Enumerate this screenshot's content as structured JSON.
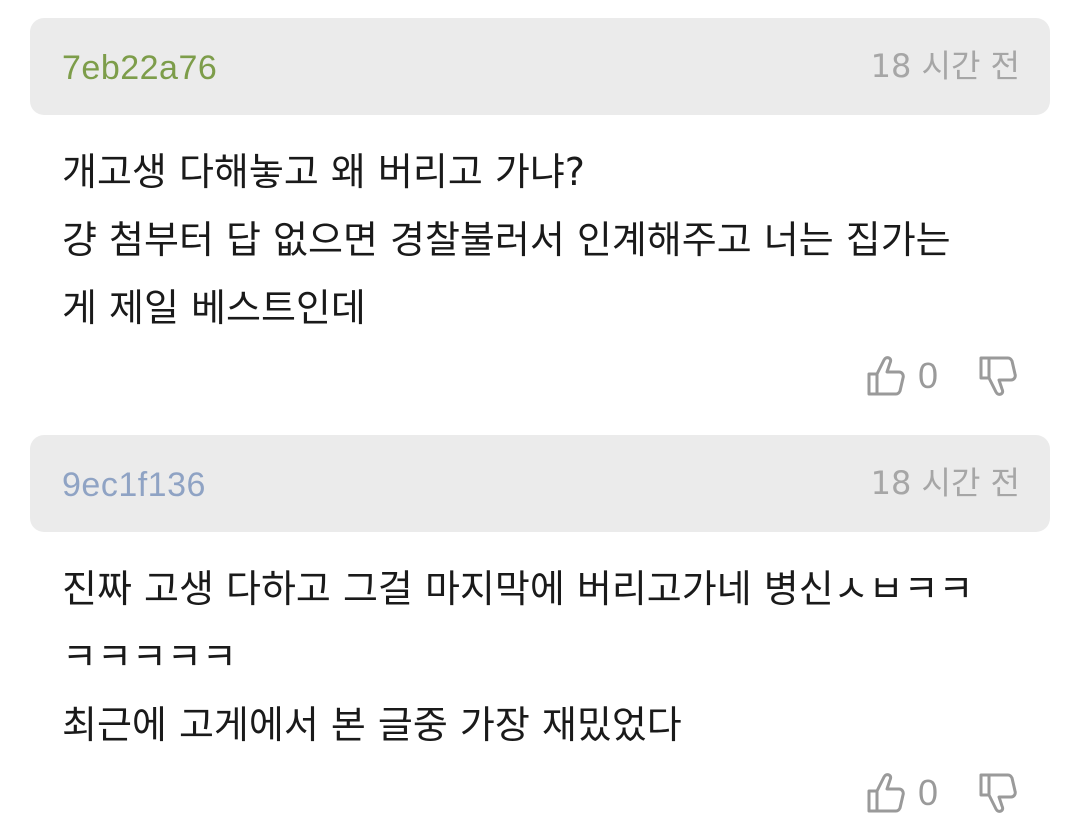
{
  "comments": [
    {
      "author": "7eb22a76",
      "author_color": "#7d9d4a",
      "time": "18 시간 전",
      "body_lines": [
        "개고생 다해놓고 왜 버리고 가냐?",
        "걍 첨부터 답 없으면 경찰불러서 인계해주고 너는 집가는",
        "게 제일 베스트인데"
      ],
      "likes": "0",
      "like_icon": "thumbs-up-icon",
      "dislike_icon": "thumbs-down-icon"
    },
    {
      "author": "9ec1f136",
      "author_color": "#8fa3c4",
      "time": "18 시간 전",
      "body_lines": [
        "진짜 고생 다하고 그걸 마지막에 버리고가네 병신ㅅㅂㅋㅋ",
        "ㅋㅋㅋㅋㅋ",
        "최근에 고게에서 본 글중 가장 재밌었다"
      ],
      "likes": "0",
      "like_icon": "thumbs-up-icon",
      "dislike_icon": "thumbs-down-icon"
    }
  ]
}
